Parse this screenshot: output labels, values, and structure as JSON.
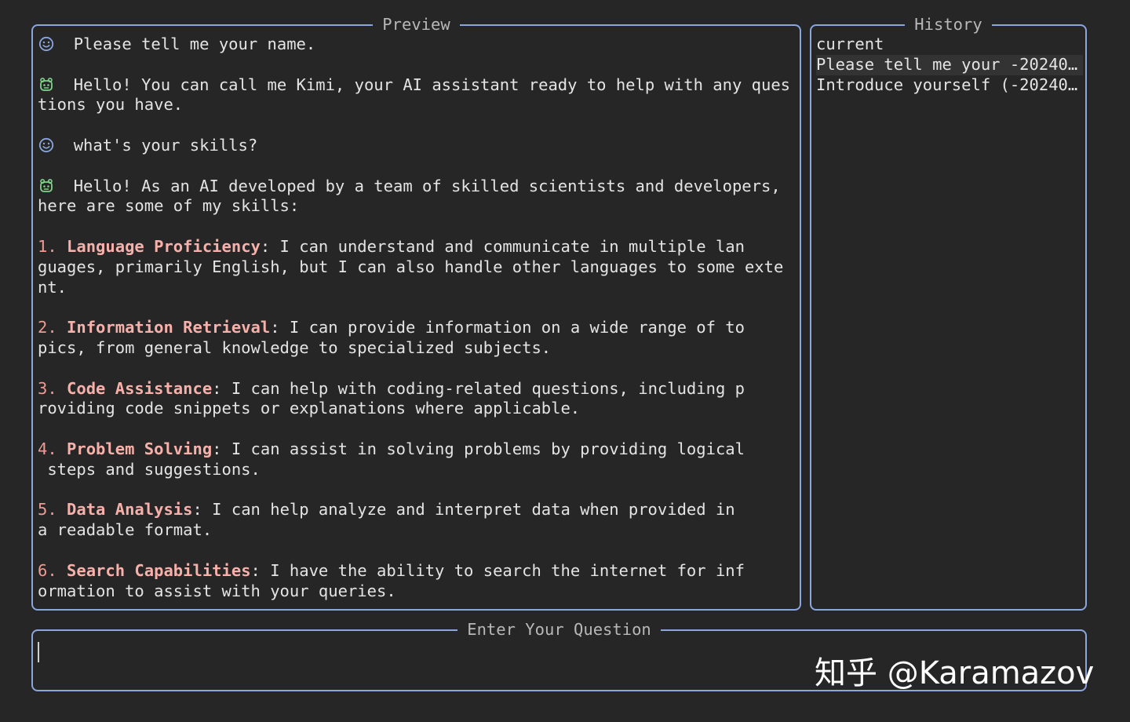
{
  "panels": {
    "preview_title": "Preview",
    "history_title": "History",
    "input_title": "Enter Your Question"
  },
  "colors": {
    "border": "#8aa6dc",
    "accent": "#f09a94",
    "background": "#262626"
  },
  "icons": {
    "user": "smiley-icon",
    "assistant": "robot-icon"
  },
  "conversation": [
    {
      "role": "user",
      "lines": [
        "Please tell me your name."
      ]
    },
    {
      "role": "assistant",
      "lines": [
        "Hello! You can call me Kimi, your AI assistant ready to help with any ques",
        "tions you have."
      ]
    },
    {
      "role": "user",
      "lines": [
        "what's your skills?"
      ]
    },
    {
      "role": "assistant",
      "lines": [
        "Hello! As an AI developed by a team of skilled scientists and developers,",
        "here are some of my skills:"
      ]
    }
  ],
  "skills": [
    {
      "num": "1.",
      "name": "Language Proficiency",
      "first": ": I can understand and communicate in multiple lan",
      "rest": [
        "guages, primarily English, but I can also handle other languages to some exte",
        "nt."
      ]
    },
    {
      "num": "2.",
      "name": "Information Retrieval",
      "first": ": I can provide information on a wide range of to",
      "rest": [
        "pics, from general knowledge to specialized subjects."
      ]
    },
    {
      "num": "3.",
      "name": "Code Assistance",
      "first": ": I can help with coding-related questions, including p",
      "rest": [
        "roviding code snippets or explanations where applicable."
      ]
    },
    {
      "num": "4.",
      "name": "Problem Solving",
      "first": ": I can assist in solving problems by providing logical",
      "rest": [
        " steps and suggestions."
      ]
    },
    {
      "num": "5.",
      "name": "Data Analysis",
      "first": ": I can help analyze and interpret data when provided in",
      "rest": [
        "a readable format."
      ]
    },
    {
      "num": "6.",
      "name": "Search Capabilities",
      "first": ": I have the ability to search the internet for inf",
      "rest": [
        "ormation to assist with your queries."
      ]
    }
  ],
  "history": {
    "items": [
      {
        "label": "current"
      },
      {
        "label": "Please tell me your -20240…"
      },
      {
        "label": "Introduce yourself (-20240…"
      }
    ],
    "selected_index": 1
  },
  "input": {
    "value": ""
  },
  "watermark": "知乎 @Karamazov"
}
